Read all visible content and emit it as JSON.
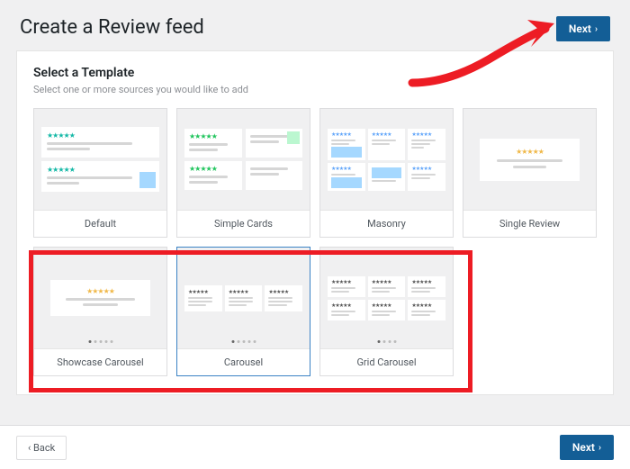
{
  "header": {
    "title": "Create a Review feed",
    "next_label": "Next"
  },
  "section": {
    "title": "Select a Template",
    "subtitle": "Select one or more sources you would like to add"
  },
  "templates": [
    {
      "label": "Default",
      "selected": false
    },
    {
      "label": "Simple Cards",
      "selected": false
    },
    {
      "label": "Masonry",
      "selected": false
    },
    {
      "label": "Single Review",
      "selected": false
    },
    {
      "label": "Showcase Carousel",
      "selected": false
    },
    {
      "label": "Carousel",
      "selected": true
    },
    {
      "label": "Grid Carousel",
      "selected": false
    }
  ],
  "footer": {
    "back_label": "Back",
    "next_label": "Next"
  },
  "annotation": {
    "highlights_templates": [
      "Showcase Carousel",
      "Carousel",
      "Grid Carousel"
    ],
    "arrow_target": "next-button-top"
  },
  "colors": {
    "primary": "#135e96",
    "annotation_red": "#ed1c24"
  }
}
